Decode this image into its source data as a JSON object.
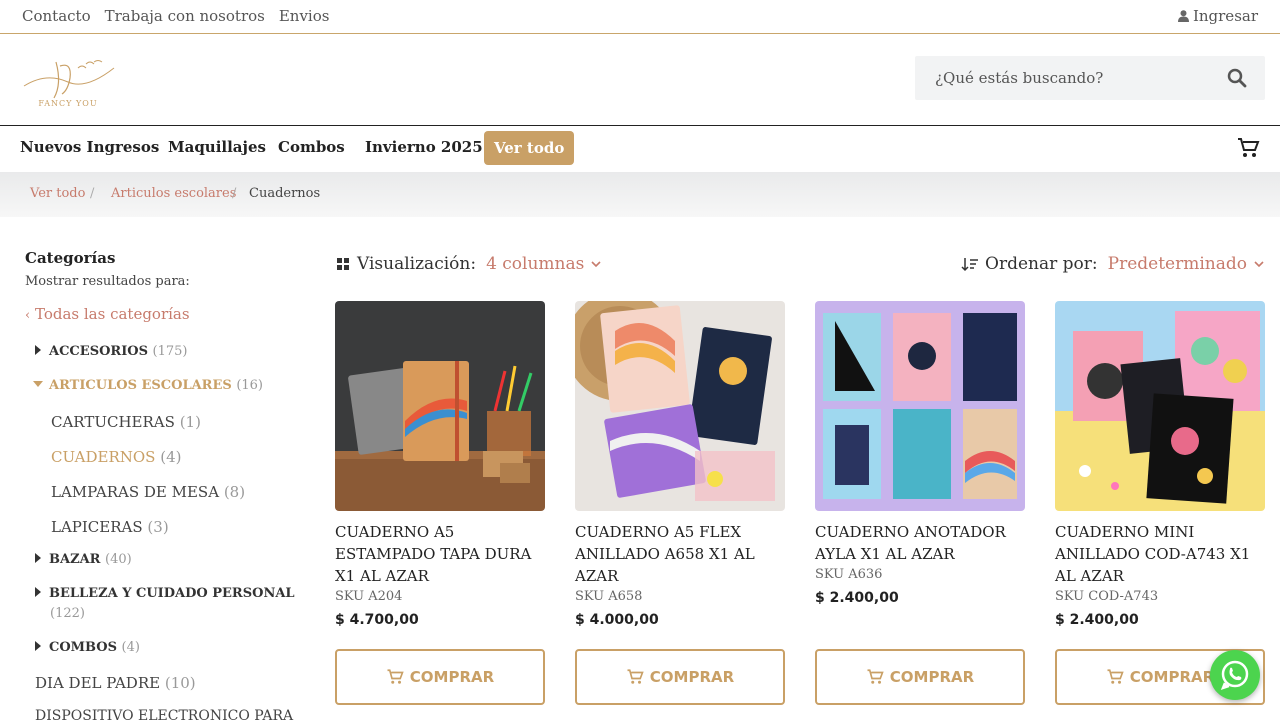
{
  "topbar": {
    "links": [
      "Contacto",
      "Trabaja con nosotros",
      "Envios"
    ],
    "login": "Ingresar"
  },
  "brand": {
    "logo_text": "FANCY YOU"
  },
  "search": {
    "placeholder": "¿Qué estás buscando?",
    "value": ""
  },
  "nav": {
    "items": [
      "Nuevos Ingresos",
      "Maquillajes",
      "Combos",
      "Invierno 2025"
    ],
    "highlight": "Ver todo"
  },
  "breadcrumb": [
    "Ver todo",
    "Articulos escolares",
    "Cuadernos"
  ],
  "sidebar": {
    "title": "Categorías",
    "subtitle": "Mostrar resultados para:",
    "all_label": "Todas las categorías",
    "categories": [
      {
        "label": "ACCESORIOS",
        "count": "(175)"
      },
      {
        "label": "ARTICULOS ESCOLARES",
        "count": "(16)"
      },
      {
        "label": "CARTUCHERAS",
        "count": "(1)"
      },
      {
        "label": "CUADERNOS",
        "count": "(4)"
      },
      {
        "label": "LAMPARAS DE MESA",
        "count": "(8)"
      },
      {
        "label": "LAPICERAS",
        "count": "(3)"
      },
      {
        "label": "BAZAR",
        "count": "(40)"
      },
      {
        "label": "BELLEZA Y CUIDADO PERSONAL",
        "count": "(122)"
      },
      {
        "label": "COMBOS",
        "count": "(4)"
      },
      {
        "label": "DIA DEL PADRE",
        "count": "(10)"
      },
      {
        "label": "DISPOSITIVO ELECTRONICO PARA",
        "count": ""
      }
    ]
  },
  "toolbar": {
    "view_label": "Visualización:",
    "view_value": "4 columnas",
    "sort_label": "Ordenar por:",
    "sort_value": "Predeterminado"
  },
  "products": [
    {
      "name": "CUADERNO A5 ESTAMPADO TAPA DURA X1 AL AZAR",
      "sku": "SKU A204",
      "price": "$  4.700,00"
    },
    {
      "name": "CUADERNO A5 FLEX ANILLADO A658 X1 AL AZAR",
      "sku": "SKU A658",
      "price": "$  4.000,00"
    },
    {
      "name": "CUADERNO ANOTADOR AYLA X1 AL AZAR",
      "sku": "SKU A636",
      "price": "$  2.400,00"
    },
    {
      "name": "CUADERNO MINI ANILLADO COD-A743 X1 AL AZAR",
      "sku": "SKU COD-A743",
      "price": "$  2.400,00"
    }
  ],
  "buy_label": "COMPRAR",
  "colors": {
    "gold": "#c9a066",
    "rose": "#c77b6c",
    "whatsapp": "#4cd44e"
  }
}
